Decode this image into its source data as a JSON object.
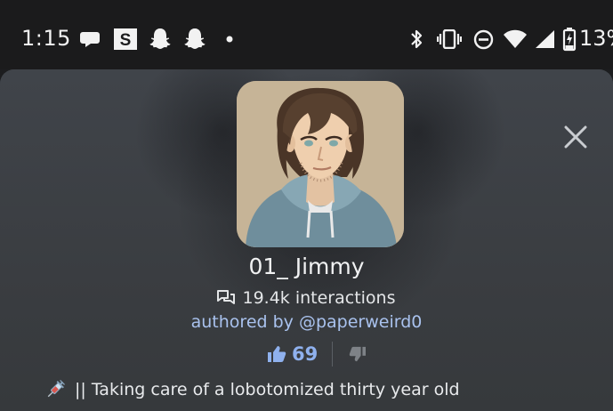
{
  "status_bar": {
    "time": "1:15",
    "notification_icons": [
      "chat-bubble-icon",
      "s-app-icon",
      "snapchat-icon",
      "snapchat-icon",
      "more-dot-icon"
    ],
    "system_icons": [
      "bluetooth-icon",
      "vibrate-icon",
      "do-not-disturb-icon",
      "wifi-icon",
      "cell-signal-icon",
      "battery-charging-icon"
    ],
    "battery_percent": "13%"
  },
  "character": {
    "name": "01_ Jimmy",
    "interactions": "19.4k interactions",
    "author": "authored by @paperweird0",
    "likes": "69",
    "tagline_emoji": "💉",
    "tagline": "|| Taking care of a lobotomized thirty year old"
  },
  "colors": {
    "accent": "#8fb1ee",
    "author_link": "#a9c2ee",
    "sheet_bg": "#3a3d40",
    "status_bar_bg": "#1b1b1c"
  }
}
